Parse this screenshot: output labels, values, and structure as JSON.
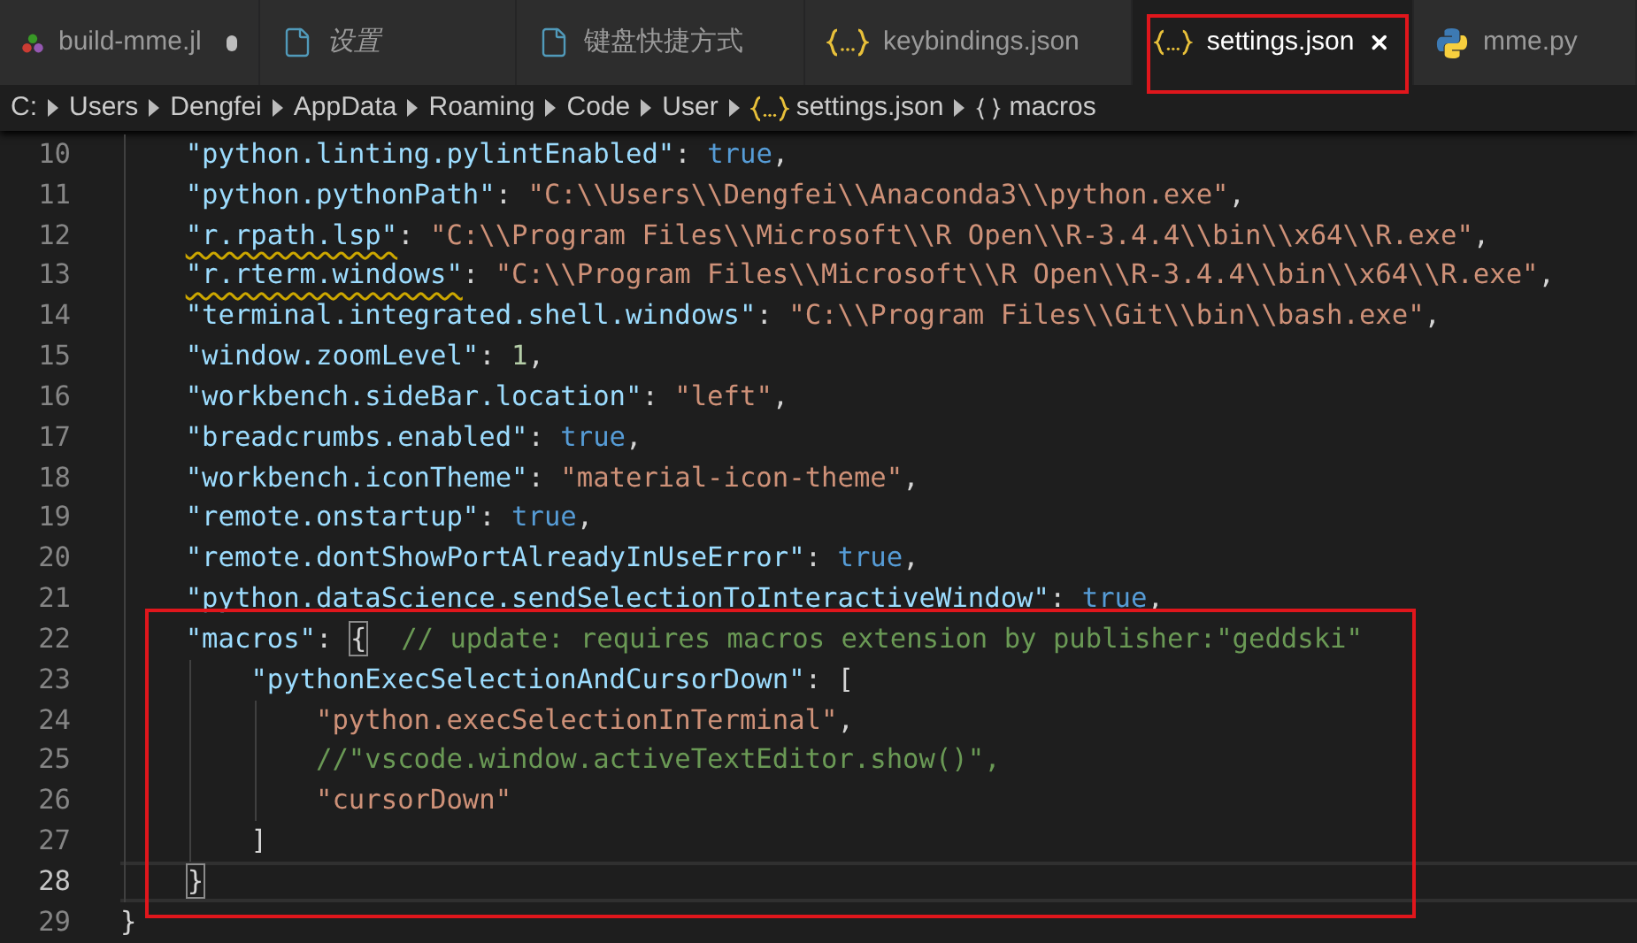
{
  "tabs": [
    {
      "label": "build-mme.jl",
      "kind": "julia",
      "selected": false,
      "italic": false,
      "modified": true,
      "highlighted": false
    },
    {
      "label": "设置",
      "kind": "file",
      "selected": false,
      "italic": true,
      "modified": false,
      "highlighted": false
    },
    {
      "label": "键盘快捷方式",
      "kind": "file",
      "selected": false,
      "italic": false,
      "modified": false,
      "highlighted": false
    },
    {
      "label": "keybindings.json",
      "kind": "json",
      "selected": false,
      "italic": false,
      "modified": false,
      "highlighted": false
    },
    {
      "label": "settings.json",
      "kind": "json",
      "selected": true,
      "italic": false,
      "modified": false,
      "highlighted": true
    },
    {
      "label": "mme.py",
      "kind": "python",
      "selected": false,
      "italic": false,
      "modified": false,
      "highlighted": false
    }
  ],
  "breadcrumbs": [
    {
      "label": "C:",
      "kind": "folder"
    },
    {
      "label": "Users",
      "kind": "folder"
    },
    {
      "label": "Dengfei",
      "kind": "folder"
    },
    {
      "label": "AppData",
      "kind": "folder"
    },
    {
      "label": "Roaming",
      "kind": "folder"
    },
    {
      "label": "Code",
      "kind": "folder"
    },
    {
      "label": "User",
      "kind": "folder"
    },
    {
      "label": "settings.json",
      "kind": "file"
    },
    {
      "label": "macros",
      "kind": "symbol"
    }
  ],
  "lines": [
    {
      "number": "10",
      "current": false,
      "highlighted": false,
      "tokens": [
        {
          "text": "    \"python.linting.pylintEnabled\"",
          "kind": "key"
        },
        {
          "text": ": ",
          "kind": "punct"
        },
        {
          "text": "true",
          "kind": "keyword"
        },
        {
          "text": ",",
          "kind": "punct"
        }
      ]
    },
    {
      "number": "11",
      "current": false,
      "highlighted": false,
      "tokens": [
        {
          "text": "    \"python.pythonPath\"",
          "kind": "key"
        },
        {
          "text": ": ",
          "kind": "punct"
        },
        {
          "text": "\"C:\\\\Users\\\\Dengfei\\\\Anaconda3\\\\python.exe\"",
          "kind": "string"
        },
        {
          "text": ",",
          "kind": "punct"
        }
      ]
    },
    {
      "number": "12",
      "current": false,
      "highlighted": false,
      "tokens": [
        {
          "text": "    \"r.rpath.lsp\"",
          "kind": "key",
          "warning": true
        },
        {
          "text": ": ",
          "kind": "punct"
        },
        {
          "text": "\"C:\\\\Program Files\\\\Microsoft\\\\R Open\\\\R-3.4.4\\\\bin\\\\x64\\\\R.exe\"",
          "kind": "string"
        },
        {
          "text": ",",
          "kind": "punct"
        }
      ]
    },
    {
      "number": "13",
      "current": false,
      "highlighted": false,
      "tokens": [
        {
          "text": "    \"r.rterm.windows\"",
          "kind": "key",
          "warning": true
        },
        {
          "text": ": ",
          "kind": "punct"
        },
        {
          "text": "\"C:\\\\Program Files\\\\Microsoft\\\\R Open\\\\R-3.4.4\\\\bin\\\\x64\\\\R.exe\"",
          "kind": "string"
        },
        {
          "text": ",",
          "kind": "punct"
        }
      ]
    },
    {
      "number": "14",
      "current": false,
      "highlighted": false,
      "tokens": [
        {
          "text": "    \"terminal.integrated.shell.windows\"",
          "kind": "key"
        },
        {
          "text": ": ",
          "kind": "punct"
        },
        {
          "text": "\"C:\\\\Program Files\\\\Git\\\\bin\\\\bash.exe\"",
          "kind": "string"
        },
        {
          "text": ",",
          "kind": "punct"
        }
      ]
    },
    {
      "number": "15",
      "current": false,
      "highlighted": false,
      "tokens": [
        {
          "text": "    \"window.zoomLevel\"",
          "kind": "key"
        },
        {
          "text": ": ",
          "kind": "punct"
        },
        {
          "text": "1",
          "kind": "number"
        },
        {
          "text": ",",
          "kind": "punct"
        }
      ]
    },
    {
      "number": "16",
      "current": false,
      "highlighted": false,
      "tokens": [
        {
          "text": "    \"workbench.sideBar.location\"",
          "kind": "key"
        },
        {
          "text": ": ",
          "kind": "punct"
        },
        {
          "text": "\"left\"",
          "kind": "string"
        },
        {
          "text": ",",
          "kind": "punct"
        }
      ]
    },
    {
      "number": "17",
      "current": false,
      "highlighted": false,
      "tokens": [
        {
          "text": "    \"breadcrumbs.enabled\"",
          "kind": "key"
        },
        {
          "text": ": ",
          "kind": "punct"
        },
        {
          "text": "true",
          "kind": "keyword"
        },
        {
          "text": ",",
          "kind": "punct"
        }
      ]
    },
    {
      "number": "18",
      "current": false,
      "highlighted": false,
      "tokens": [
        {
          "text": "    \"workbench.iconTheme\"",
          "kind": "key"
        },
        {
          "text": ": ",
          "kind": "punct"
        },
        {
          "text": "\"material-icon-theme\"",
          "kind": "string"
        },
        {
          "text": ",",
          "kind": "punct"
        }
      ]
    },
    {
      "number": "19",
      "current": false,
      "highlighted": false,
      "tokens": [
        {
          "text": "    \"remote.onstartup\"",
          "kind": "key"
        },
        {
          "text": ": ",
          "kind": "punct"
        },
        {
          "text": "true",
          "kind": "keyword"
        },
        {
          "text": ",",
          "kind": "punct"
        }
      ]
    },
    {
      "number": "20",
      "current": false,
      "highlighted": false,
      "tokens": [
        {
          "text": "    \"remote.dontShowPortAlreadyInUseError\"",
          "kind": "key"
        },
        {
          "text": ": ",
          "kind": "punct"
        },
        {
          "text": "true",
          "kind": "keyword"
        },
        {
          "text": ",",
          "kind": "punct"
        }
      ]
    },
    {
      "number": "21",
      "current": false,
      "highlighted": false,
      "tokens": [
        {
          "text": "    \"python.dataScience.sendSelectionToInteractiveWindow\"",
          "kind": "key"
        },
        {
          "text": ": ",
          "kind": "punct"
        },
        {
          "text": "true",
          "kind": "keyword"
        },
        {
          "text": ",",
          "kind": "punct"
        }
      ]
    },
    {
      "number": "22",
      "current": false,
      "highlighted": true,
      "tokens": [
        {
          "text": "    \"macros\"",
          "kind": "key"
        },
        {
          "text": ": ",
          "kind": "punct"
        },
        {
          "text": "{",
          "kind": "punct",
          "bracket_match": true
        },
        {
          "text": "  // update: requires macros extension by publisher:\"geddski\"",
          "kind": "comment"
        }
      ]
    },
    {
      "number": "23",
      "current": false,
      "highlighted": true,
      "tokens": [
        {
          "text": "        \"pythonExecSelectionAndCursorDown\"",
          "kind": "key"
        },
        {
          "text": ": [",
          "kind": "punct"
        }
      ]
    },
    {
      "number": "24",
      "current": false,
      "highlighted": true,
      "tokens": [
        {
          "text": "            \"python.execSelectionInTerminal\"",
          "kind": "string"
        },
        {
          "text": ",",
          "kind": "punct"
        }
      ]
    },
    {
      "number": "25",
      "current": false,
      "highlighted": true,
      "tokens": [
        {
          "text": "            //\"vscode.window.activeTextEditor.show()\",",
          "kind": "comment"
        }
      ]
    },
    {
      "number": "26",
      "current": false,
      "highlighted": true,
      "tokens": [
        {
          "text": "            \"cursorDown\"",
          "kind": "string"
        }
      ]
    },
    {
      "number": "27",
      "current": false,
      "highlighted": true,
      "tokens": [
        {
          "text": "        ]",
          "kind": "punct"
        }
      ]
    },
    {
      "number": "28",
      "current": true,
      "highlighted": true,
      "tokens": [
        {
          "text": "    }",
          "kind": "punct",
          "bracket_match": true
        }
      ]
    },
    {
      "number": "29",
      "current": false,
      "highlighted": false,
      "tokens": [
        {
          "text": "}",
          "kind": "punct"
        }
      ]
    }
  ]
}
